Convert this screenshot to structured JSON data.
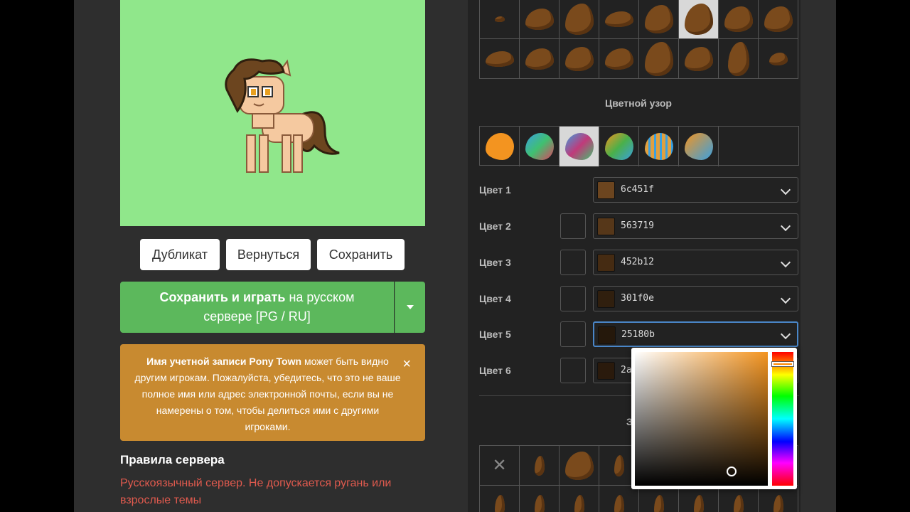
{
  "preview": {
    "background": "#90e78b"
  },
  "buttons": {
    "duplicate": "Дубликат",
    "revert": "Вернуться",
    "save": "Сохранить"
  },
  "play": {
    "bold": "Сохранить и играть",
    "rest_line1": " на русском",
    "line2": "сервере [PG / RU]"
  },
  "alert": {
    "bold": "Имя учетной записи Pony Town",
    "text": " может быть видно другим игрокам. Пожалуйста, убедитесь, что это не ваше полное имя или адрес электронной почты, если вы не намерены о том, чтобы делиться ими с другими игроками.",
    "close": "×"
  },
  "rules": {
    "title": "Правила сервера",
    "text": "Русскоязычный сервер. Не допускается ругань или взрослые темы"
  },
  "sections": {
    "pattern": "Цветной узор",
    "back_partial": "Задн"
  },
  "colors": [
    {
      "label": "Цвет 1",
      "hex": "6c451f",
      "swatch": "#6c451f",
      "lockable": false
    },
    {
      "label": "Цвет 2",
      "hex": "563719",
      "swatch": "#563719",
      "lockable": true
    },
    {
      "label": "Цвет 3",
      "hex": "452b12",
      "swatch": "#452b12",
      "lockable": true
    },
    {
      "label": "Цвет 4",
      "hex": "301f0e",
      "swatch": "#301f0e",
      "lockable": true
    },
    {
      "label": "Цвет 5",
      "hex": "25180b",
      "swatch": "#25180b",
      "lockable": true,
      "active": true
    },
    {
      "label": "Цвет 6",
      "hex": "2a",
      "swatch": "#2a1a0c",
      "lockable": true
    }
  ],
  "pattern_colors": [
    "#f39420",
    "#3aa0e0",
    "#c03a7a",
    "#4ab04a",
    "#e0a040",
    "#f39420"
  ],
  "picker": {
    "hue_color": "#f39420"
  },
  "bottom_grid_remove": "✕"
}
